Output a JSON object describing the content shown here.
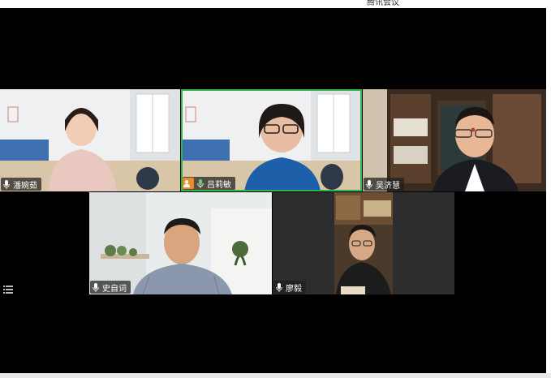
{
  "window": {
    "title": "腾讯会议"
  },
  "participants": [
    {
      "name": "潘婉茹"
    },
    {
      "name": "吕莉敏"
    },
    {
      "name": "吴济慧"
    },
    {
      "name": "史自词"
    },
    {
      "name": "廖毅"
    }
  ],
  "icons": {
    "mic": "mic-icon",
    "menu": "list-menu-icon",
    "avatar": "person-icon"
  },
  "colors": {
    "active_speaker_border": "#2fb84a",
    "label_bg": "#1e1e1e",
    "avatar_badge": "#f08a24"
  }
}
